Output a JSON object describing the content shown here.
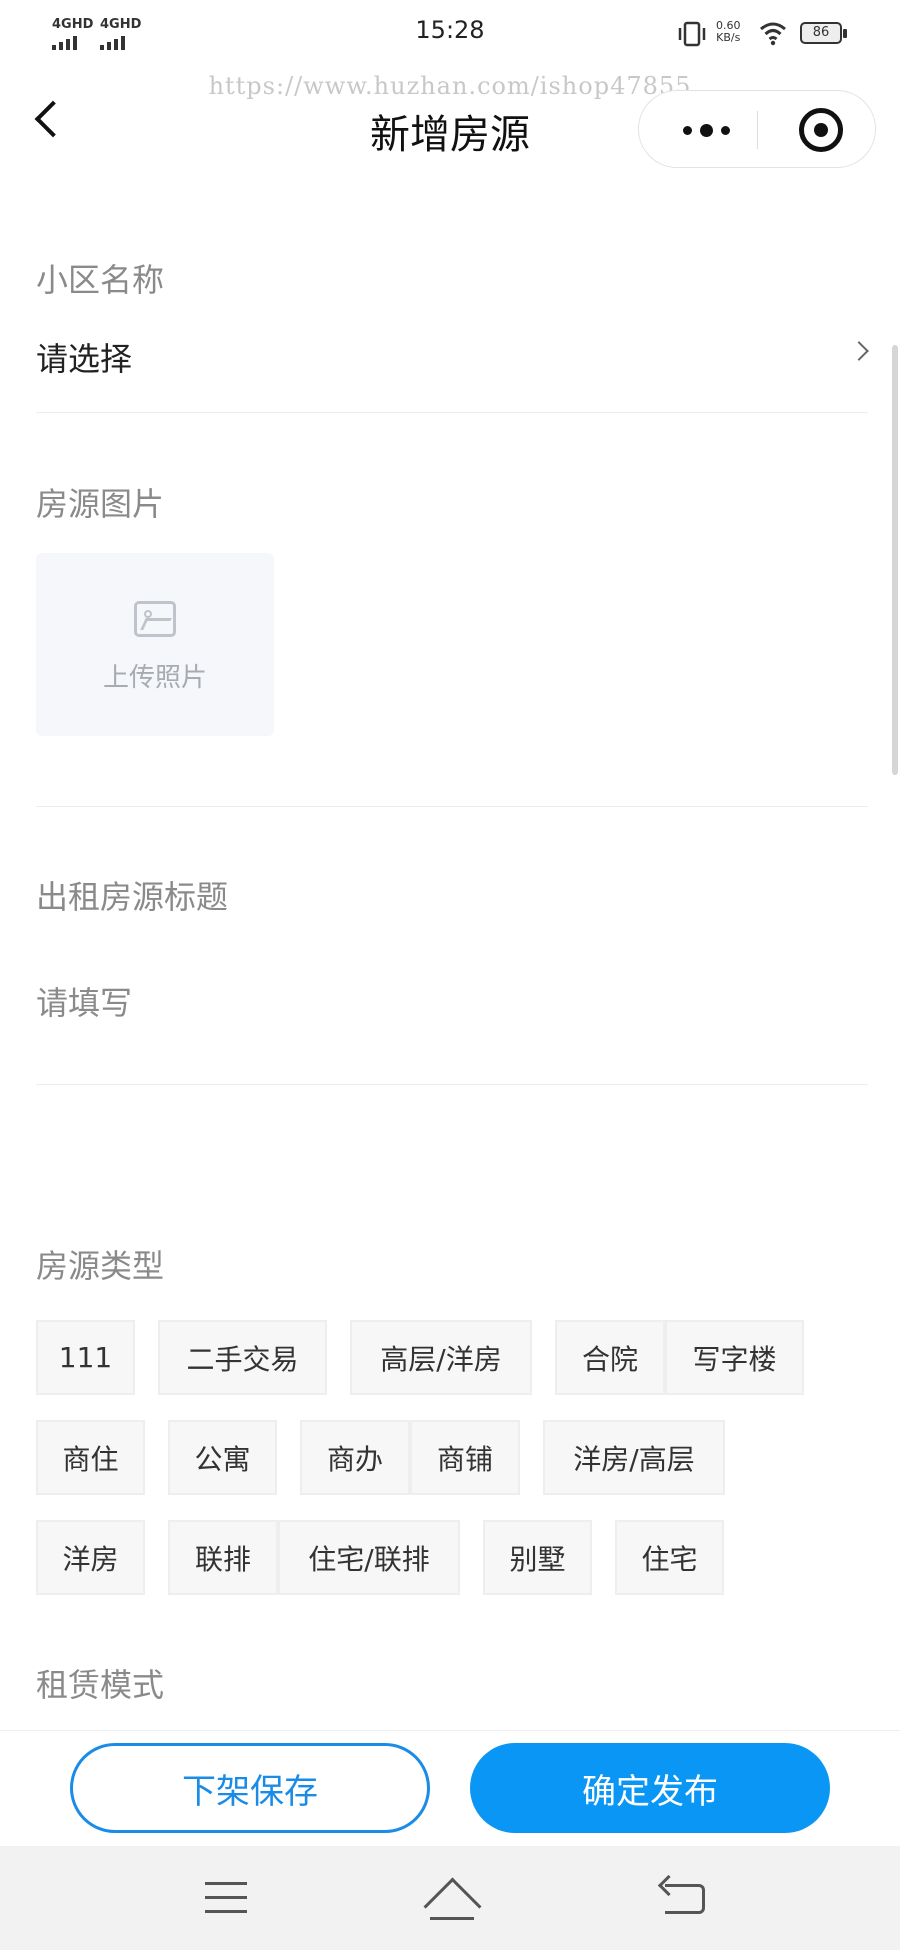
{
  "status_bar": {
    "signal_1": "4GHD",
    "signal_2": "4GHD",
    "time": "15:28",
    "net_speed_value": "0.60",
    "net_speed_unit": "KB/s",
    "battery": "86"
  },
  "watermark": "https://www.huzhan.com/ishop47855",
  "nav": {
    "title": "新增房源"
  },
  "form": {
    "community": {
      "label": "小区名称",
      "value": "请选择"
    },
    "photos": {
      "label": "房源图片",
      "upload_caption": "上传照片"
    },
    "rent_title": {
      "label": "出租房源标题",
      "placeholder": "请填写"
    },
    "property_type": {
      "label": "房源类型",
      "options": [
        "111",
        "二手交易",
        "高层/洋房",
        "合院",
        "写字楼",
        "商住",
        "公寓",
        "商办",
        "商铺",
        "洋房/高层",
        "洋房",
        "联排",
        "住宅/联排",
        "别墅",
        "住宅"
      ]
    },
    "rental_mode": {
      "label": "租赁模式"
    }
  },
  "actions": {
    "unlist_save": "下架保存",
    "publish": "确定发布"
  }
}
